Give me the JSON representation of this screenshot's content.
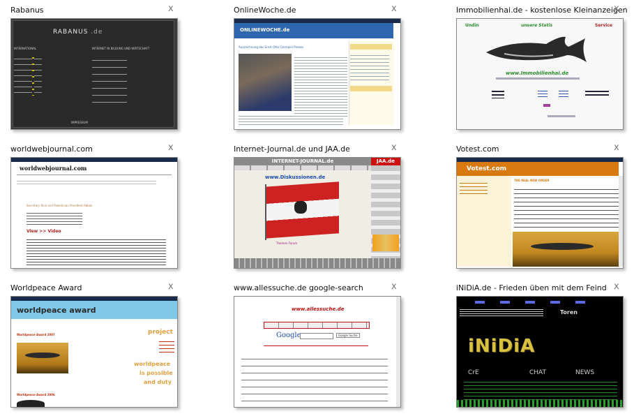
{
  "tiles": [
    {
      "title": "Rabanus"
    },
    {
      "title": "OnlineWoche.de"
    },
    {
      "title": "Immobilienhai.de - kostenlose Kleinanzeigen"
    },
    {
      "title": "worldwebjournal.com"
    },
    {
      "title": "Internet-Journal.de und JAA.de"
    },
    {
      "title": "Votest.com"
    },
    {
      "title": "Worldpeace Award"
    },
    {
      "title": "www.allessuche.de google-search"
    },
    {
      "title": "iNiDiA.de - Frieden üben mit dem Feind"
    }
  ],
  "close_glyph": "x",
  "thumbs": {
    "rabanus": {
      "logo": "RABANUS",
      "ext": ".de",
      "col1": "INTERNATIONAL",
      "col2": "INTERNET IN BILDUNG UND WIRTSCHAFT",
      "footer": "IMPRESSUM"
    },
    "onlinewoche": {
      "logo": "ONLINEWOCHE.de",
      "headline": "Auszeichnung des Ernst-Otto Czempiel Preises"
    },
    "immobilienhai": {
      "nav1": "Undin",
      "nav2": "unsere Statis",
      "nav3": "Service",
      "site": "www.Immobilienhai.de"
    },
    "worldwebjournal": {
      "logo": "worldwebjournal.com",
      "headline": "Secretary Rice and Palestinian President Abbas",
      "view": "View >> Video"
    },
    "internetjournal": {
      "banner": "INTERNET-JOURNAL.de",
      "jaa": "JAA.de",
      "disk": "www.Diskussionen.de",
      "links": "Themen  Forum"
    },
    "votest": {
      "logo": "Votest.com",
      "heading": "THE REAL NEW ORDER"
    },
    "worldpeace": {
      "logo": "worldpeace award",
      "post1": "Worldpeace Award 2007",
      "post2": "Worldpeace Award 2006",
      "project": "project",
      "slogan1": "worldpeace",
      "slogan2": "is possible",
      "slogan3": "and duty"
    },
    "allessuche": {
      "logo": "www.allessuche.de",
      "google": "Google",
      "button": "Google Suche"
    },
    "inidia": {
      "word": "iNiDiA",
      "toren": "Toren",
      "c1": "CrE",
      "c2": "CHAT",
      "c3": "NEWS"
    }
  }
}
